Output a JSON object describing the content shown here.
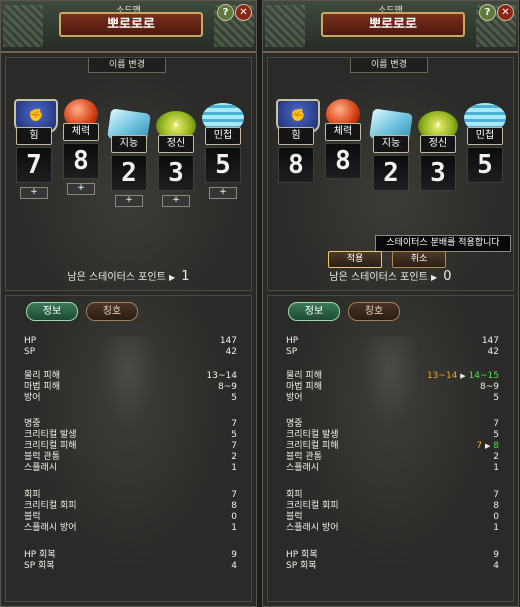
{
  "window": {
    "job": "소드맨",
    "name": "뽀로로로",
    "help_label": "?",
    "close_label": "✕"
  },
  "status": {
    "rename_label": "이름 변경",
    "increment_label": "+",
    "remaining_label": "남은 스테이터스 포인트",
    "arrow": "▶",
    "apply_label": "적용",
    "cancel_label": "취소",
    "tooltip": "스테이터스 분배를 적용합니다"
  },
  "stats_labels": [
    "힘",
    "체력",
    "지능",
    "정신",
    "민첩"
  ],
  "stat_icons": [
    "power-icon",
    "health-icon",
    "intelligence-icon",
    "spirit-icon",
    "agility-icon"
  ],
  "left": {
    "stat_values": [
      "7",
      "8",
      "2",
      "3",
      "5"
    ],
    "remaining": "1"
  },
  "right": {
    "stat_values": [
      "8",
      "8",
      "2",
      "3",
      "5"
    ],
    "remaining": "0"
  },
  "tabs": {
    "info": "정보",
    "title": "칭호"
  },
  "info_left": {
    "hp_label": "HP",
    "hp": "147",
    "sp_label": "SP",
    "sp": "42",
    "phys_label": "물리 피해",
    "phys": "13~14",
    "magic_label": "마법 피해",
    "magic": "8~9",
    "def_label": "방어",
    "def": "5",
    "acc_label": "명중",
    "acc": "7",
    "crit_label": "크리티컬 발생",
    "crit": "5",
    "critdmg_label": "크리티컬 피해",
    "critdmg": "7",
    "blockpen_label": "블럭 관통",
    "blockpen": "2",
    "splash_label": "스플래시",
    "splash": "1",
    "eva_label": "회피",
    "eva": "7",
    "criteva_label": "크리티컬 회피",
    "criteva": "8",
    "block_label": "블럭",
    "block": "0",
    "splashdef_label": "스플래시 방어",
    "splashdef": "1",
    "hpregen_label": "HP 회복",
    "hpregen": "9",
    "spregen_label": "SP 회복",
    "spregen": "4"
  },
  "info_right": {
    "hp": "147",
    "sp": "42",
    "phys_old": "13~14",
    "phys_arrow": "▶",
    "phys_new": "14~15",
    "magic": "8~9",
    "def": "5",
    "acc": "7",
    "crit": "5",
    "critdmg_old": "7",
    "critdmg_arrow": "▶",
    "critdmg_new": "8",
    "blockpen": "2",
    "splash": "1",
    "eva": "7",
    "criteva": "8",
    "block": "0",
    "splashdef": "1",
    "hpregen": "9",
    "spregen": "4"
  },
  "colors": {
    "old_value": "#f2a526",
    "new_value": "#4ee04a",
    "name_plate": "#7a2f1c"
  }
}
